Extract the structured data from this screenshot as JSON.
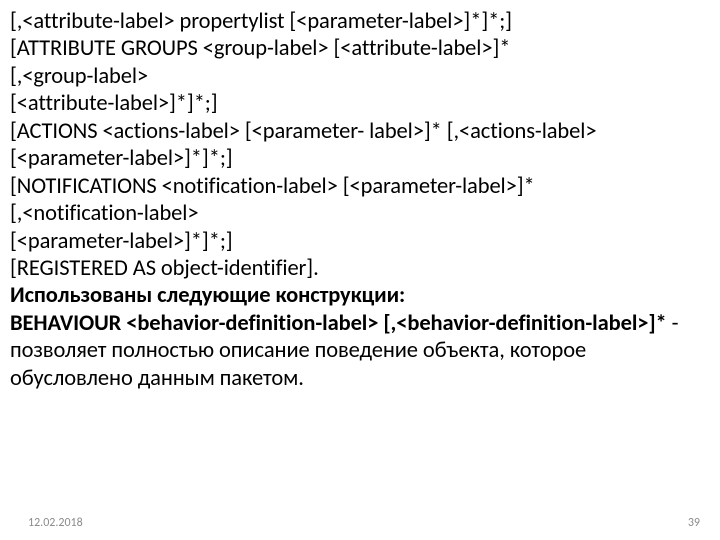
{
  "lines": {
    "l1": "[,<attribute-label> propertylist [<parameter-label>]*]*;]",
    "l2": "[ATTRIBUTE GROUPS <group-label> [<attribute-label>]*",
    "l3": "[,<group-label>",
    "l4": "[<attribute-label>]*]*;]",
    "l5": "[ACTIONS <actions-label> [<parameter- label>]* [,<actions-label>",
    "l6": "[<parameter-label>]*]*;]",
    "l7": "[NOTIFICATIONS <notification-label> [<parameter-label>]*",
    "l8": "[,<notification-label>",
    "l9": "[<parameter-label>]*]*;]",
    "l10": "[REGISTERED AS object-identifier].",
    "l11": "Использованы следующие конструкции:",
    "l12a": "BEHAVIOUR <behavior-definition-label> [,<behavior-definition-label>]*",
    "l12b": " - позволяет полностью описание поведение объекта, которое обусловлено данным пакетом.",
    "date": "12.02.2018",
    "page": "39"
  }
}
